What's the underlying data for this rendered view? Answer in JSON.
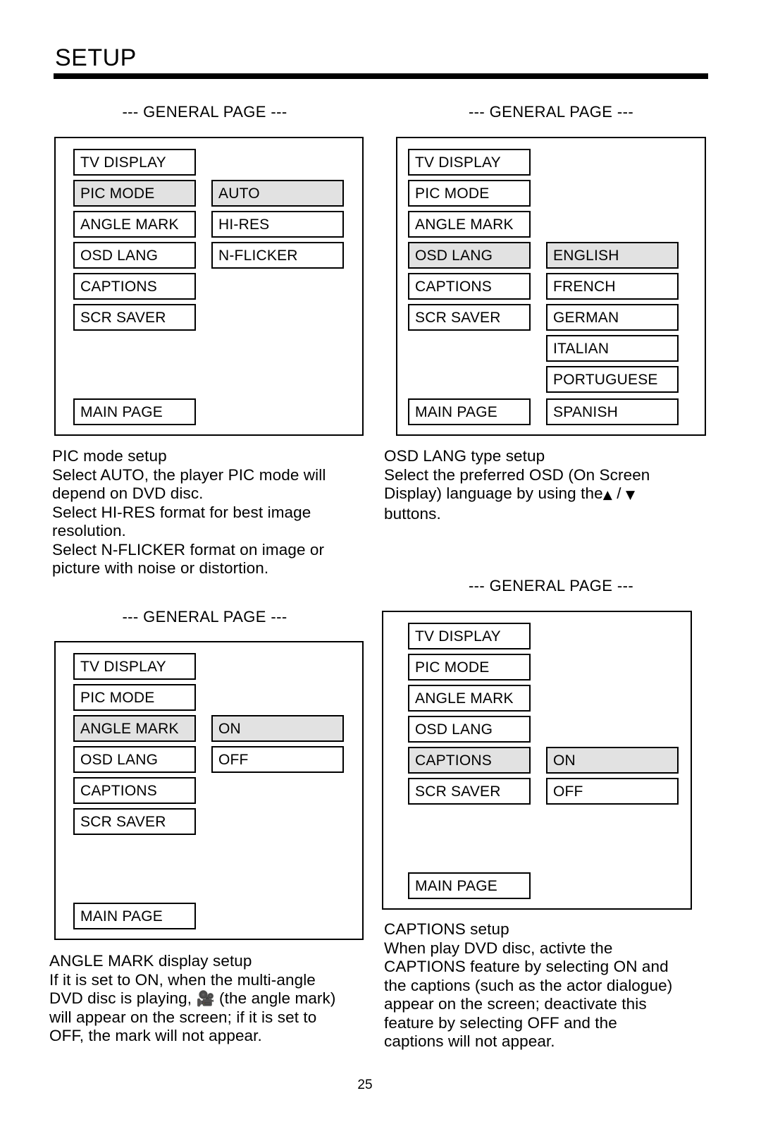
{
  "document": {
    "section_title": "SETUP",
    "page_number": "25"
  },
  "panels": [
    {
      "id": "pic-mode",
      "caption": "--- GENERAL PAGE ---",
      "menu_items": [
        {
          "label": "TV DISPLAY",
          "highlighted": false
        },
        {
          "label": "PIC MODE",
          "highlighted": true
        },
        {
          "label": "ANGLE MARK",
          "highlighted": false
        },
        {
          "label": "OSD LANG",
          "highlighted": false
        },
        {
          "label": "CAPTIONS",
          "highlighted": false
        },
        {
          "label": "SCR SAVER",
          "highlighted": false
        }
      ],
      "main_page_label": "MAIN PAGE",
      "options": [
        {
          "label": "AUTO",
          "highlighted": true
        },
        {
          "label": "HI-RES",
          "highlighted": false
        },
        {
          "label": "N-FLICKER",
          "highlighted": false
        }
      ]
    },
    {
      "id": "osd-lang",
      "caption": "--- GENERAL PAGE ---",
      "menu_items": [
        {
          "label": "TV DISPLAY",
          "highlighted": false
        },
        {
          "label": "PIC MODE",
          "highlighted": false
        },
        {
          "label": "ANGLE MARK",
          "highlighted": false
        },
        {
          "label": "OSD LANG",
          "highlighted": true
        },
        {
          "label": "CAPTIONS",
          "highlighted": false
        },
        {
          "label": "SCR SAVER",
          "highlighted": false
        }
      ],
      "main_page_label": "MAIN PAGE",
      "options": [
        {
          "label": "ENGLISH",
          "highlighted": true
        },
        {
          "label": "FRENCH",
          "highlighted": false
        },
        {
          "label": "GERMAN",
          "highlighted": false
        },
        {
          "label": "ITALIAN",
          "highlighted": false
        },
        {
          "label": "PORTUGUESE",
          "highlighted": false
        },
        {
          "label": "SPANISH",
          "highlighted": false
        }
      ]
    },
    {
      "id": "angle-mark",
      "caption": "--- GENERAL PAGE ---",
      "menu_items": [
        {
          "label": "TV DISPLAY",
          "highlighted": false
        },
        {
          "label": "PIC MODE",
          "highlighted": false
        },
        {
          "label": "ANGLE MARK",
          "highlighted": true
        },
        {
          "label": "OSD LANG",
          "highlighted": false
        },
        {
          "label": "CAPTIONS",
          "highlighted": false
        },
        {
          "label": "SCR SAVER",
          "highlighted": false
        }
      ],
      "main_page_label": "MAIN PAGE",
      "options": [
        {
          "label": "ON",
          "highlighted": true
        },
        {
          "label": "OFF",
          "highlighted": false
        }
      ]
    },
    {
      "id": "captions",
      "caption": "--- GENERAL PAGE ---",
      "menu_items": [
        {
          "label": "TV DISPLAY",
          "highlighted": false
        },
        {
          "label": "PIC MODE",
          "highlighted": false
        },
        {
          "label": "ANGLE MARK",
          "highlighted": false
        },
        {
          "label": "OSD LANG",
          "highlighted": false
        },
        {
          "label": "CAPTIONS",
          "highlighted": true
        },
        {
          "label": "SCR SAVER",
          "highlighted": false
        }
      ],
      "main_page_label": "MAIN PAGE",
      "options": [
        {
          "label": "ON",
          "highlighted": true
        },
        {
          "label": "OFF",
          "highlighted": false
        }
      ]
    }
  ],
  "descriptions": {
    "pic_mode": {
      "heading": "PIC mode setup",
      "lines": [
        "Select AUTO, the player PIC mode will",
        "depend on DVD disc.",
        "Select HI-RES format for best image",
        "resolution.",
        "Select N-FLICKER format on image or",
        "picture with noise or distortion."
      ]
    },
    "osd_lang": {
      "heading": "OSD LANG type setup",
      "line1": "Select the preferred OSD (On Screen",
      "line2_a": "Display) language by using the",
      "line2_up": "▲",
      "line2_sep": "/",
      "line2_down": "▼",
      "line3": "buttons."
    },
    "angle_mark": {
      "heading": "ANGLE MARK display setup",
      "line1": "If it is set to ON, when the multi-angle",
      "line2_a": "DVD disc is playing,",
      "line2_icon": "🎥",
      "line2_b": "(the angle mark)",
      "line3": "will appear on the screen; if it is set to",
      "line4": "OFF, the mark will not appear."
    },
    "captions": {
      "heading": "CAPTIONS setup",
      "lines": [
        "When play DVD disc, activte the",
        "CAPTIONS feature by selecting ON and",
        "the captions (such as the actor dialogue)",
        "appear on the screen; deactivate this",
        "feature by selecting OFF and the",
        "captions will not appear."
      ]
    }
  }
}
